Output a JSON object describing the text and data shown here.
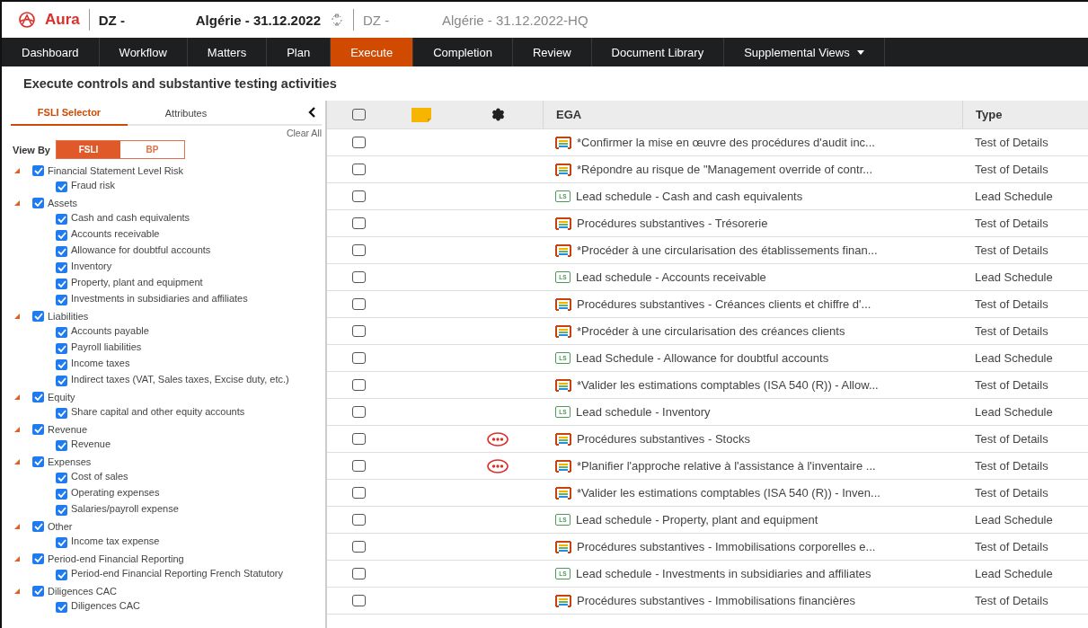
{
  "header": {
    "brand": "Aura",
    "entity_code": "DZ -",
    "engagement": "Algérie - 31.12.2022",
    "secondary_code": "DZ -",
    "secondary_engagement": "Algérie - 31.12.2022-HQ"
  },
  "nav": [
    {
      "label": "Dashboard",
      "selected": false
    },
    {
      "label": "Workflow",
      "selected": false
    },
    {
      "label": "Matters",
      "selected": false
    },
    {
      "label": "Plan",
      "selected": false
    },
    {
      "label": "Execute",
      "selected": true
    },
    {
      "label": "Completion",
      "selected": false
    },
    {
      "label": "Review",
      "selected": false
    },
    {
      "label": "Document Library",
      "selected": false
    },
    {
      "label": "Supplemental Views",
      "selected": false,
      "dropdown": true
    }
  ],
  "page_title": "Execute controls and substantive testing activities",
  "selector": {
    "tabs": [
      {
        "label": "FSLI Selector",
        "selected": true
      },
      {
        "label": "Attributes",
        "selected": false
      }
    ],
    "clear_all": "Clear All",
    "view_by_label": "View By",
    "view_by": [
      {
        "label": "FSLI",
        "selected": true
      },
      {
        "label": "BP",
        "selected": false
      }
    ],
    "tree": [
      {
        "label": "Financial Statement Level Risk",
        "checked": true,
        "expanded": true,
        "children": [
          {
            "label": "Fraud risk",
            "checked": true
          }
        ]
      },
      {
        "label": "Assets",
        "checked": true,
        "expanded": true,
        "children": [
          {
            "label": "Cash and cash equivalents",
            "checked": true
          },
          {
            "label": "Accounts receivable",
            "checked": true
          },
          {
            "label": "Allowance for doubtful accounts",
            "checked": true
          },
          {
            "label": "Inventory",
            "checked": true
          },
          {
            "label": "Property, plant and equipment",
            "checked": true
          },
          {
            "label": "Investments in subsidiaries and affiliates",
            "checked": true
          }
        ]
      },
      {
        "label": "Liabilities",
        "checked": true,
        "expanded": true,
        "children": [
          {
            "label": "Accounts payable",
            "checked": true
          },
          {
            "label": "Payroll liabilities",
            "checked": true
          },
          {
            "label": "Income taxes",
            "checked": true
          },
          {
            "label": "Indirect taxes (VAT, Sales taxes, Excise duty, etc.)",
            "checked": true
          }
        ]
      },
      {
        "label": "Equity",
        "checked": true,
        "expanded": true,
        "children": [
          {
            "label": "Share capital and other equity accounts",
            "checked": true
          }
        ]
      },
      {
        "label": "Revenue",
        "checked": true,
        "expanded": true,
        "children": [
          {
            "label": "Revenue",
            "checked": true
          }
        ]
      },
      {
        "label": "Expenses",
        "checked": true,
        "expanded": true,
        "children": [
          {
            "label": "Cost of sales",
            "checked": true
          },
          {
            "label": "Operating expenses",
            "checked": true
          },
          {
            "label": "Salaries/payroll expense",
            "checked": true
          }
        ]
      },
      {
        "label": "Other",
        "checked": true,
        "expanded": true,
        "children": [
          {
            "label": "Income tax expense",
            "checked": true
          }
        ]
      },
      {
        "label": "Period-end Financial Reporting",
        "checked": true,
        "expanded": true,
        "children": [
          {
            "label": "Period-end Financial Reporting French Statutory",
            "checked": true
          }
        ]
      },
      {
        "label": "Diligences CAC",
        "checked": true,
        "expanded": true,
        "children": [
          {
            "label": "Diligences CAC",
            "checked": true
          }
        ]
      }
    ]
  },
  "table": {
    "header_checked": false,
    "columns": [
      "EGA",
      "Type"
    ],
    "rows": [
      {
        "checked": false,
        "alert": false,
        "kind": "test",
        "ega": "*Confirmer la mise en œuvre des procédures d'audit inc...",
        "type": "Test of Details"
      },
      {
        "checked": false,
        "alert": false,
        "kind": "test",
        "ega": "*Répondre au risque de \"Management override of contr...",
        "type": "Test of Details"
      },
      {
        "checked": false,
        "alert": false,
        "kind": "lead",
        "badge": "LS",
        "ega": "Lead schedule - Cash and cash equivalents",
        "type": "Lead Schedule"
      },
      {
        "checked": false,
        "alert": false,
        "kind": "test",
        "ega": "Procédures substantives - Trésorerie",
        "type": "Test of Details"
      },
      {
        "checked": false,
        "alert": false,
        "kind": "test",
        "ega": "*Procéder à une circularisation des établissements finan...",
        "type": "Test of Details"
      },
      {
        "checked": false,
        "alert": false,
        "kind": "lead",
        "badge": "LS",
        "ega": "Lead schedule - Accounts receivable",
        "type": "Lead Schedule"
      },
      {
        "checked": false,
        "alert": false,
        "kind": "test",
        "ega": "Procédures substantives - Créances clients et chiffre d'...",
        "type": "Test of Details"
      },
      {
        "checked": false,
        "alert": false,
        "kind": "test",
        "ega": "*Procéder à une circularisation des créances clients",
        "type": "Test of Details"
      },
      {
        "checked": false,
        "alert": false,
        "kind": "lead",
        "badge": "LS",
        "ega": "Lead Schedule - Allowance for doubtful accounts",
        "type": "Lead Schedule"
      },
      {
        "checked": false,
        "alert": false,
        "kind": "test",
        "ega": "*Valider les estimations comptables (ISA 540 (R)) - Allow...",
        "type": "Test of Details"
      },
      {
        "checked": false,
        "alert": false,
        "kind": "lead",
        "badge": "LS",
        "ega": "Lead schedule - Inventory",
        "type": "Lead Schedule"
      },
      {
        "checked": false,
        "alert": true,
        "kind": "test",
        "ega": "Procédures substantives - Stocks",
        "type": "Test of Details"
      },
      {
        "checked": false,
        "alert": true,
        "kind": "test",
        "ega": "*Planifier l'approche relative à l'assistance à l'inventaire ...",
        "type": "Test of Details"
      },
      {
        "checked": false,
        "alert": false,
        "kind": "test",
        "ega": "*Valider les estimations comptables (ISA 540 (R)) - Inven...",
        "type": "Test of Details"
      },
      {
        "checked": false,
        "alert": false,
        "kind": "lead",
        "badge": "LS",
        "ega": "Lead schedule - Property, plant and equipment",
        "type": "Lead Schedule"
      },
      {
        "checked": false,
        "alert": false,
        "kind": "test",
        "ega": "Procédures substantives - Immobilisations corporelles e...",
        "type": "Test of Details"
      },
      {
        "checked": false,
        "alert": false,
        "kind": "lead",
        "badge": "LS",
        "ega": "Lead schedule - Investments in subsidiaries and affiliates",
        "type": "Lead Schedule"
      },
      {
        "checked": false,
        "alert": false,
        "kind": "test",
        "ega": "Procédures substantives - Immobilisations financières",
        "type": "Test of Details"
      }
    ]
  }
}
